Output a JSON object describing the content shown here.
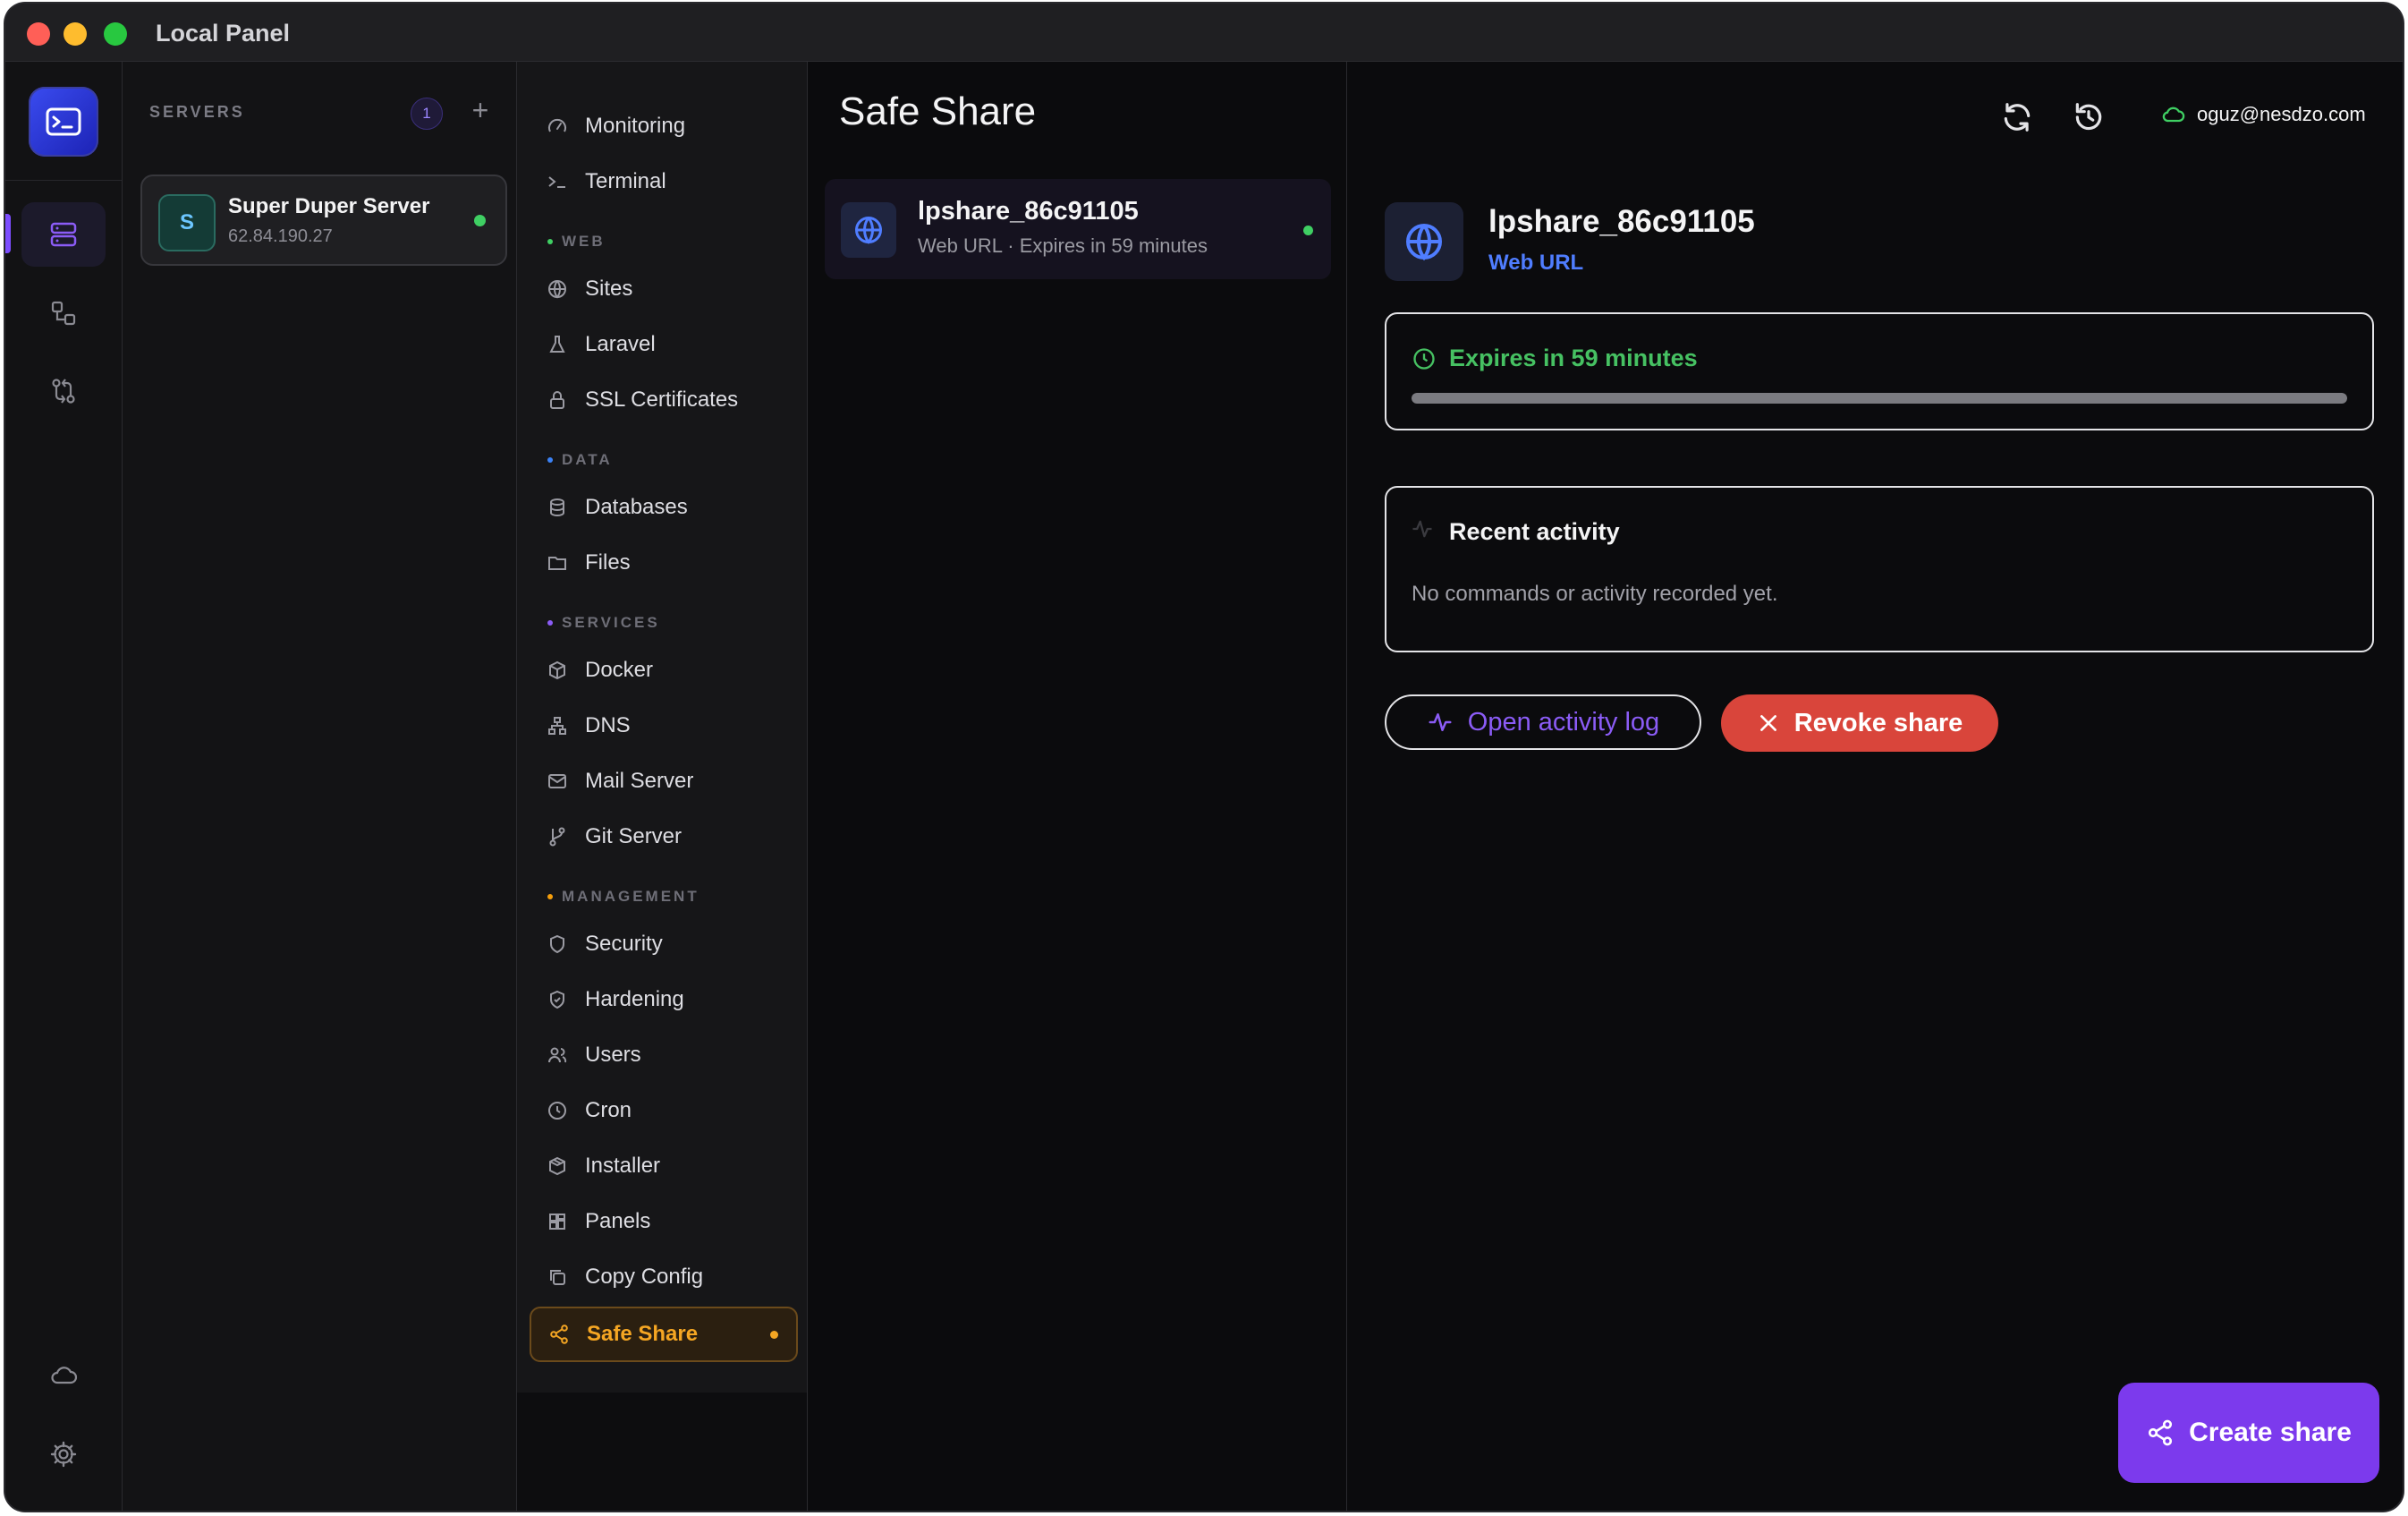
{
  "app": {
    "title": "Local Panel"
  },
  "servers": {
    "heading": "SERVERS",
    "count": "1",
    "add_label": "+",
    "items": [
      {
        "initial": "S",
        "name": "Super Duper Server",
        "ip": "62.84.190.27",
        "status": "online"
      }
    ]
  },
  "nav": {
    "items_top": [
      {
        "label": "Monitoring",
        "icon": "gauge-icon"
      },
      {
        "label": "Terminal",
        "icon": "terminal-icon"
      }
    ],
    "sections": [
      {
        "title": "WEB",
        "color": "#3fcf63",
        "items": [
          {
            "label": "Sites",
            "icon": "globe-icon"
          },
          {
            "label": "Laravel",
            "icon": "flask-icon"
          },
          {
            "label": "SSL Certificates",
            "icon": "lock-icon"
          }
        ]
      },
      {
        "title": "DATA",
        "color": "#3b82f6",
        "items": [
          {
            "label": "Databases",
            "icon": "database-icon"
          },
          {
            "label": "Files",
            "icon": "folder-icon"
          }
        ]
      },
      {
        "title": "SERVICES",
        "color": "#8b5cf6",
        "items": [
          {
            "label": "Docker",
            "icon": "box-icon"
          },
          {
            "label": "DNS",
            "icon": "network-icon"
          },
          {
            "label": "Mail Server",
            "icon": "mail-icon"
          },
          {
            "label": "Git Server",
            "icon": "git-branch-icon"
          }
        ]
      },
      {
        "title": "MANAGEMENT",
        "color": "#f59e0b",
        "items": [
          {
            "label": "Security",
            "icon": "shield-icon"
          },
          {
            "label": "Hardening",
            "icon": "shield-check-icon"
          },
          {
            "label": "Users",
            "icon": "users-icon"
          },
          {
            "label": "Cron",
            "icon": "clock-icon"
          },
          {
            "label": "Installer",
            "icon": "package-icon"
          },
          {
            "label": "Panels",
            "icon": "grid-icon"
          },
          {
            "label": "Copy Config",
            "icon": "copy-icon"
          },
          {
            "label": "Safe Share",
            "icon": "share-icon",
            "active": true
          }
        ]
      }
    ]
  },
  "page": {
    "title": "Safe Share"
  },
  "header": {
    "account_email": "oguz@nesdzo.com"
  },
  "shares": [
    {
      "name": "lpshare_86c91105",
      "subtitle": "Web URL · Expires in 59 minutes",
      "status": "active"
    }
  ],
  "detail": {
    "name": "lpshare_86c91105",
    "type": "Web URL",
    "expiry_text": "Expires in 59 minutes",
    "expiry_remaining_fraction": 1.0,
    "activity_title": "Recent activity",
    "activity_empty": "No commands or activity recorded yet.",
    "open_log_label": "Open activity log",
    "revoke_label": "Revoke share"
  },
  "create_label": "Create share",
  "colors": {
    "accent": "#7c3aed",
    "danger": "#d9453b",
    "success": "#3fcf63",
    "active_nav": "#f5a623",
    "link_blue": "#4f7dff"
  }
}
